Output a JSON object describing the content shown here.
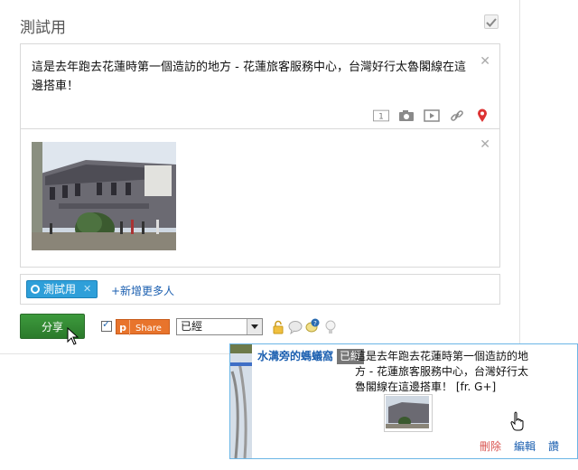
{
  "composer": {
    "title": "測試用",
    "post_text": "這是去年跑去花蓮時第一個造訪的地方 - 花蓮旅客服務中心，台灣好行太魯閣線在這邊搭車！",
    "toolbar_badge": "1"
  },
  "recipients": {
    "chip_label": "測試用",
    "add_more": "+新增更多人"
  },
  "actions": {
    "share_label": "分享",
    "plurk_share": "Share",
    "status_select": "已經"
  },
  "notification": {
    "author": "水溝旁的螞蟻窩",
    "badge": "已經",
    "text": "這是去年跑去花蓮時第一個造訪的地方 - 花蓮旅客服務中心，台灣好行太魯閣線在這邊搭車！ [fr. G+]",
    "delete": "刪除",
    "edit": "編輯",
    "like": "讚"
  },
  "colors": {
    "share": "#2b7a2b",
    "chip": "#2e9fd9",
    "plurk": "#e8742c",
    "link": "#1b5fb0"
  }
}
